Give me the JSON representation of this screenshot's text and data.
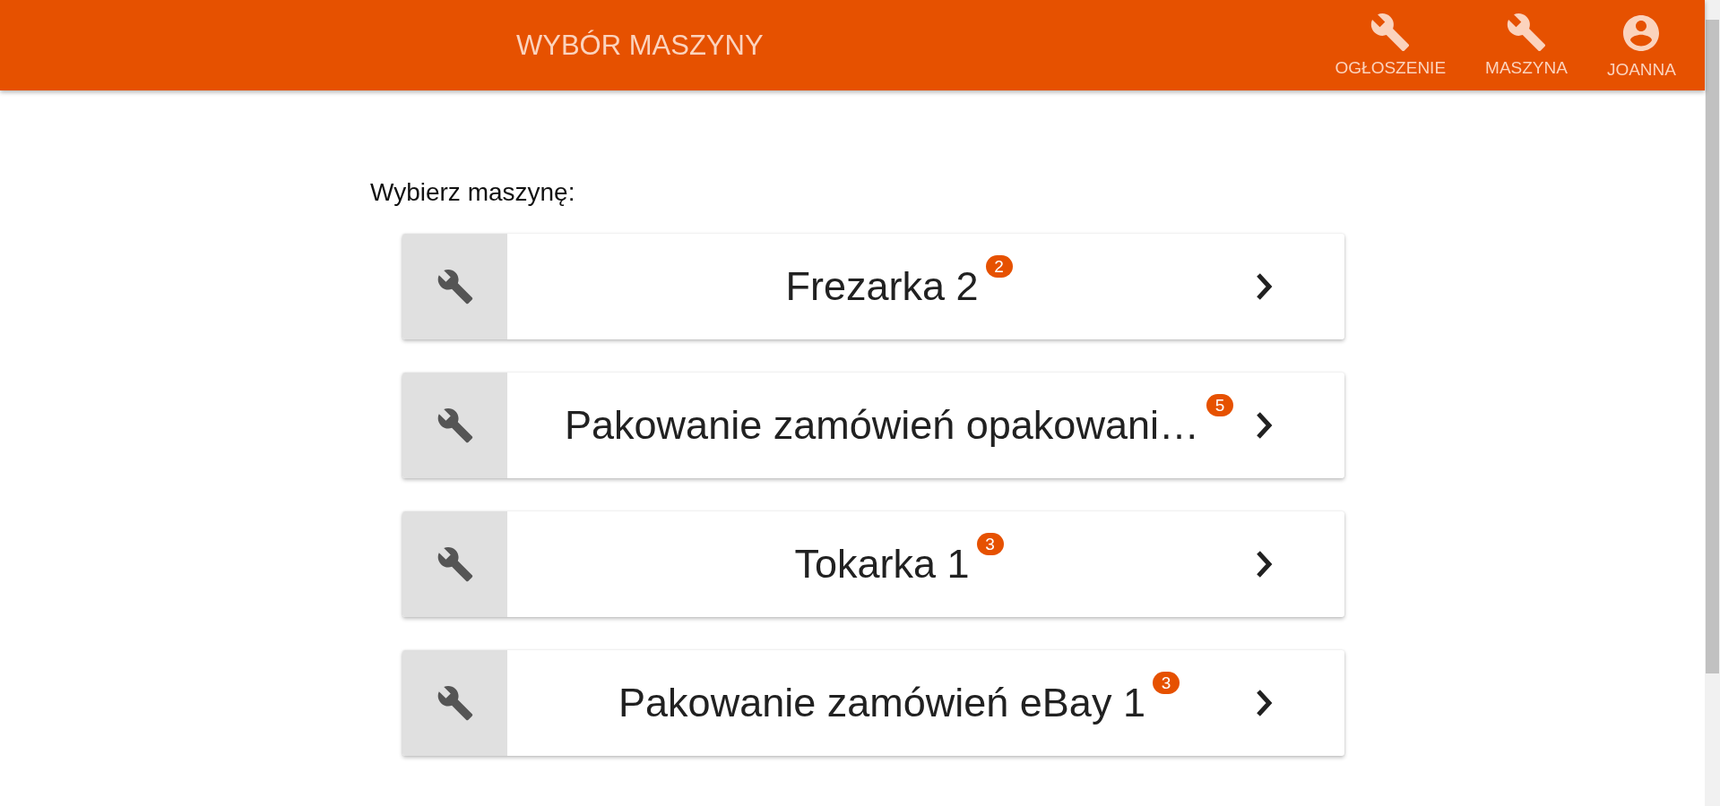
{
  "header": {
    "title": "WYBÓR MASZYNY",
    "nav": [
      {
        "label": "OGŁOSZENIE",
        "kind": "wrench"
      },
      {
        "label": "MASZYNA",
        "kind": "wrench"
      },
      {
        "label": "JOANNA",
        "kind": "account"
      }
    ]
  },
  "prompt": "Wybierz maszynę:",
  "machines": [
    {
      "name": "Frezarka 2",
      "count": "2"
    },
    {
      "name": "Pakowanie zamówień opakowani…",
      "count": "5"
    },
    {
      "name": "Tokarka 1",
      "count": "3"
    },
    {
      "name": "Pakowanie zamówień eBay 1",
      "count": "3"
    }
  ]
}
